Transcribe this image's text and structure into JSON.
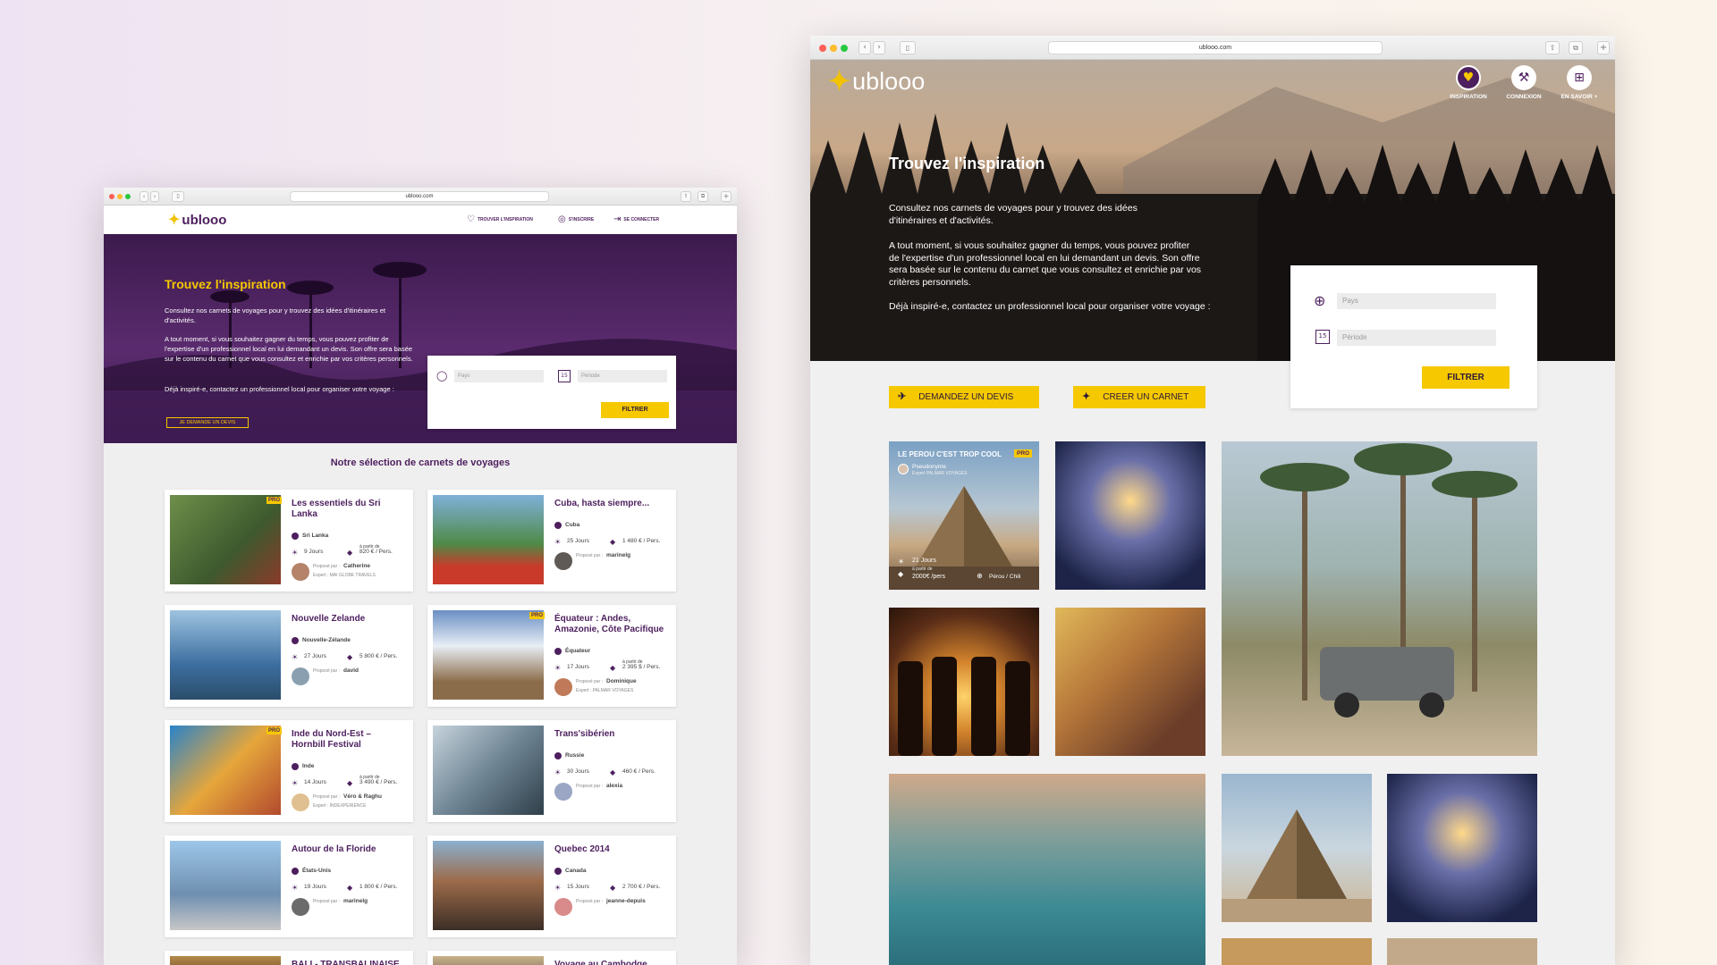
{
  "left": {
    "url": "ublooo.com",
    "logo": "ublooo",
    "nav": [
      {
        "label": "TROUVER L'INSPIRATION",
        "icon": "heart-icon"
      },
      {
        "label": "S'INSCRIRE",
        "icon": "user-icon"
      },
      {
        "label": "SE CONNECTER",
        "icon": "login-icon"
      }
    ],
    "hero": {
      "title": "Trouvez l'inspiration",
      "p1": "Consultez nos carnets de voyages pour y trouvez des idées d'itinéraires et d'activités.",
      "p2": "A tout moment, si vous souhaitez gagner du temps, vous pouvez profiter de l'expertise d'un professionnel local en lui demandant un devis. Son offre sera basée sur le contenu du carnet que vous consultez et enrichie par vos critères personnels.",
      "p3": "Déjà inspiré-e, contactez un professionnel local pour organiser votre voyage :",
      "cta": "JE DEMANDE UN DEVIS"
    },
    "filter": {
      "pays_placeholder": "Pays",
      "periode_placeholder": "Période",
      "button": "FILTRER"
    },
    "section_title": "Notre sélection de carnets de voyages",
    "cards": [
      {
        "title": "Les essentiels du Sri Lanka",
        "country": "Sri Lanka",
        "duration": "9 Jours",
        "price_prefix": "à partir de",
        "price": "820 € / Pers.",
        "by_label": "Proposé par :",
        "author": "Catherine",
        "expert": "Expert : MAI GLOBE TRAVELS",
        "pro": true
      },
      {
        "title": "Cuba, hasta siempre...",
        "country": "Cuba",
        "duration": "25 Jours",
        "price_prefix": "",
        "price": "1 480 € / Pers.",
        "by_label": "Proposé par :",
        "author": "marinelg",
        "expert": "",
        "pro": false
      },
      {
        "title": "Nouvelle Zelande",
        "country": "Nouvelle-Zélande",
        "duration": "27 Jours",
        "price_prefix": "",
        "price": "5 800 € / Pers.",
        "by_label": "Proposé par :",
        "author": "david",
        "expert": "",
        "pro": false
      },
      {
        "title": "Équateur : Andes, Amazonie, Côte Pacifique",
        "country": "Équateur",
        "duration": "17 Jours",
        "price_prefix": "à partir de",
        "price": "2 395 $ / Pers.",
        "by_label": "Proposé par :",
        "author": "Dominique",
        "expert": "Expert : PALMAR VOYAGES",
        "pro": true
      },
      {
        "title": "Inde du Nord-Est – Hornbill Festival",
        "country": "Inde",
        "duration": "14 Jours",
        "price_prefix": "à partir de",
        "price": "3 490 € / Pers.",
        "by_label": "Proposé par :",
        "author": "Véro & Raghu",
        "expert": "Expert : INDEXPERIENCE",
        "pro": true
      },
      {
        "title": "Trans'sibérien",
        "country": "Russie",
        "duration": "30 Jours",
        "price_prefix": "",
        "price": "460 € / Pers.",
        "by_label": "Proposé par :",
        "author": "alexia",
        "expert": "",
        "pro": false
      },
      {
        "title": "Autour de la Floride",
        "country": "États-Unis",
        "duration": "19 Jours",
        "price_prefix": "",
        "price": "1 800 € / Pers.",
        "by_label": "Proposé par :",
        "author": "marinelg",
        "expert": "",
        "pro": false
      },
      {
        "title": "Quebec 2014",
        "country": "Canada",
        "duration": "15 Jours",
        "price_prefix": "",
        "price": "2 700 € / Pers.",
        "by_label": "Proposé par :",
        "author": "jeanne-depuis",
        "expert": "",
        "pro": false
      },
      {
        "title": "BALI - TRANSBALINAISE",
        "country": "",
        "duration": "",
        "price_prefix": "",
        "price": "",
        "by_label": "",
        "author": "",
        "expert": "",
        "pro": false
      },
      {
        "title": "Voyage au Cambodge",
        "country": "",
        "duration": "",
        "price_prefix": "",
        "price": "",
        "by_label": "",
        "author": "",
        "expert": "",
        "pro": false
      }
    ]
  },
  "right": {
    "url": "ublooo.com",
    "logo": "ublooo",
    "nav": [
      {
        "label": "INSPIRATION",
        "icon": "heart-icon"
      },
      {
        "label": "CONNEXION",
        "icon": "wrench-icon"
      },
      {
        "label": "EN SAVOIR +",
        "icon": "grid-icon"
      }
    ],
    "hero": {
      "title": "Trouvez l'inspiration",
      "p1": "Consultez nos carnets de voyages pour y trouvez des idées d'itinéraires et d'activités.",
      "p2": "A tout moment, si vous souhaitez gagner du temps, vous pouvez profiter de l'expertise d'un professionnel local en lui demandant un devis. Son offre sera basée sur le contenu du carnet que vous consultez et enrichie par vos critères personnels.",
      "p3": "Déjà inspiré-e, contactez un professionnel local pour organiser votre voyage :"
    },
    "filter": {
      "pays_placeholder": "Pays",
      "periode_placeholder": "Période",
      "button": "FILTRER"
    },
    "actions": {
      "devis": "DEMANDEZ UN DEVIS",
      "carnet": "CREER UN CARNET"
    },
    "featured": {
      "title": "LE PEROU C'EST TROP COOL",
      "pro": "PRO",
      "author": "Pseudonyme",
      "expert": "Expert PALMAR VOYAGES",
      "duration": "21 Jours",
      "price_prefix": "à partir de",
      "price": "2000€ /pers",
      "location": "Pérou / Chili"
    }
  },
  "colors": {
    "brand_purple": "#4d1f5e",
    "accent_yellow": "#f5c800"
  }
}
